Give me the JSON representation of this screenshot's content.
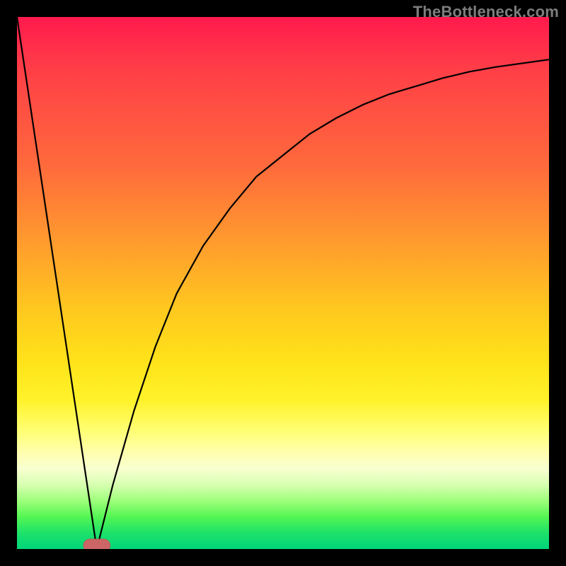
{
  "watermark": "TheBottleneck.com",
  "colors": {
    "frame": "#000000",
    "curve": "#000000",
    "marker_fill": "#cc6666",
    "marker_stroke": "#bb5a5a",
    "gradient_stops": [
      "#ff1a4d",
      "#ff3f47",
      "#ff6a3c",
      "#ff9a2e",
      "#ffc81f",
      "#ffe31a",
      "#fff22a",
      "#ffff77",
      "#ffffb0",
      "#f8ffd0",
      "#d6ffb0",
      "#9cff7a",
      "#53f553",
      "#1de26a",
      "#00d57a"
    ]
  },
  "chart_data": {
    "type": "line",
    "title": "",
    "xlabel": "",
    "ylabel": "",
    "x_range": [
      0,
      100
    ],
    "y_range": [
      0,
      100
    ],
    "notes": "Bottleneck-style curve. Y≈100 at x=0, drops to ~0 at x≈15 (the optimal point marked by a small capsule-shaped marker near the bottom), then rises with diminishing slope approaching ~92 at x=100. Background is a vertical spectrum from red (bad, high y) through yellow to green (good, low y).",
    "series": [
      {
        "name": "bottleneck-curve",
        "x": [
          0,
          3,
          6,
          9,
          12,
          15,
          18,
          22,
          26,
          30,
          35,
          40,
          45,
          50,
          55,
          60,
          65,
          70,
          75,
          80,
          85,
          90,
          95,
          100
        ],
        "y": [
          100,
          80,
          60,
          40,
          20,
          0,
          12,
          26,
          38,
          48,
          57,
          64,
          70,
          74,
          78,
          81,
          83.5,
          85.5,
          87,
          88.5,
          89.7,
          90.6,
          91.3,
          92
        ]
      }
    ],
    "optimal_marker": {
      "x": 15,
      "y": 0,
      "width_x_units": 5
    }
  }
}
